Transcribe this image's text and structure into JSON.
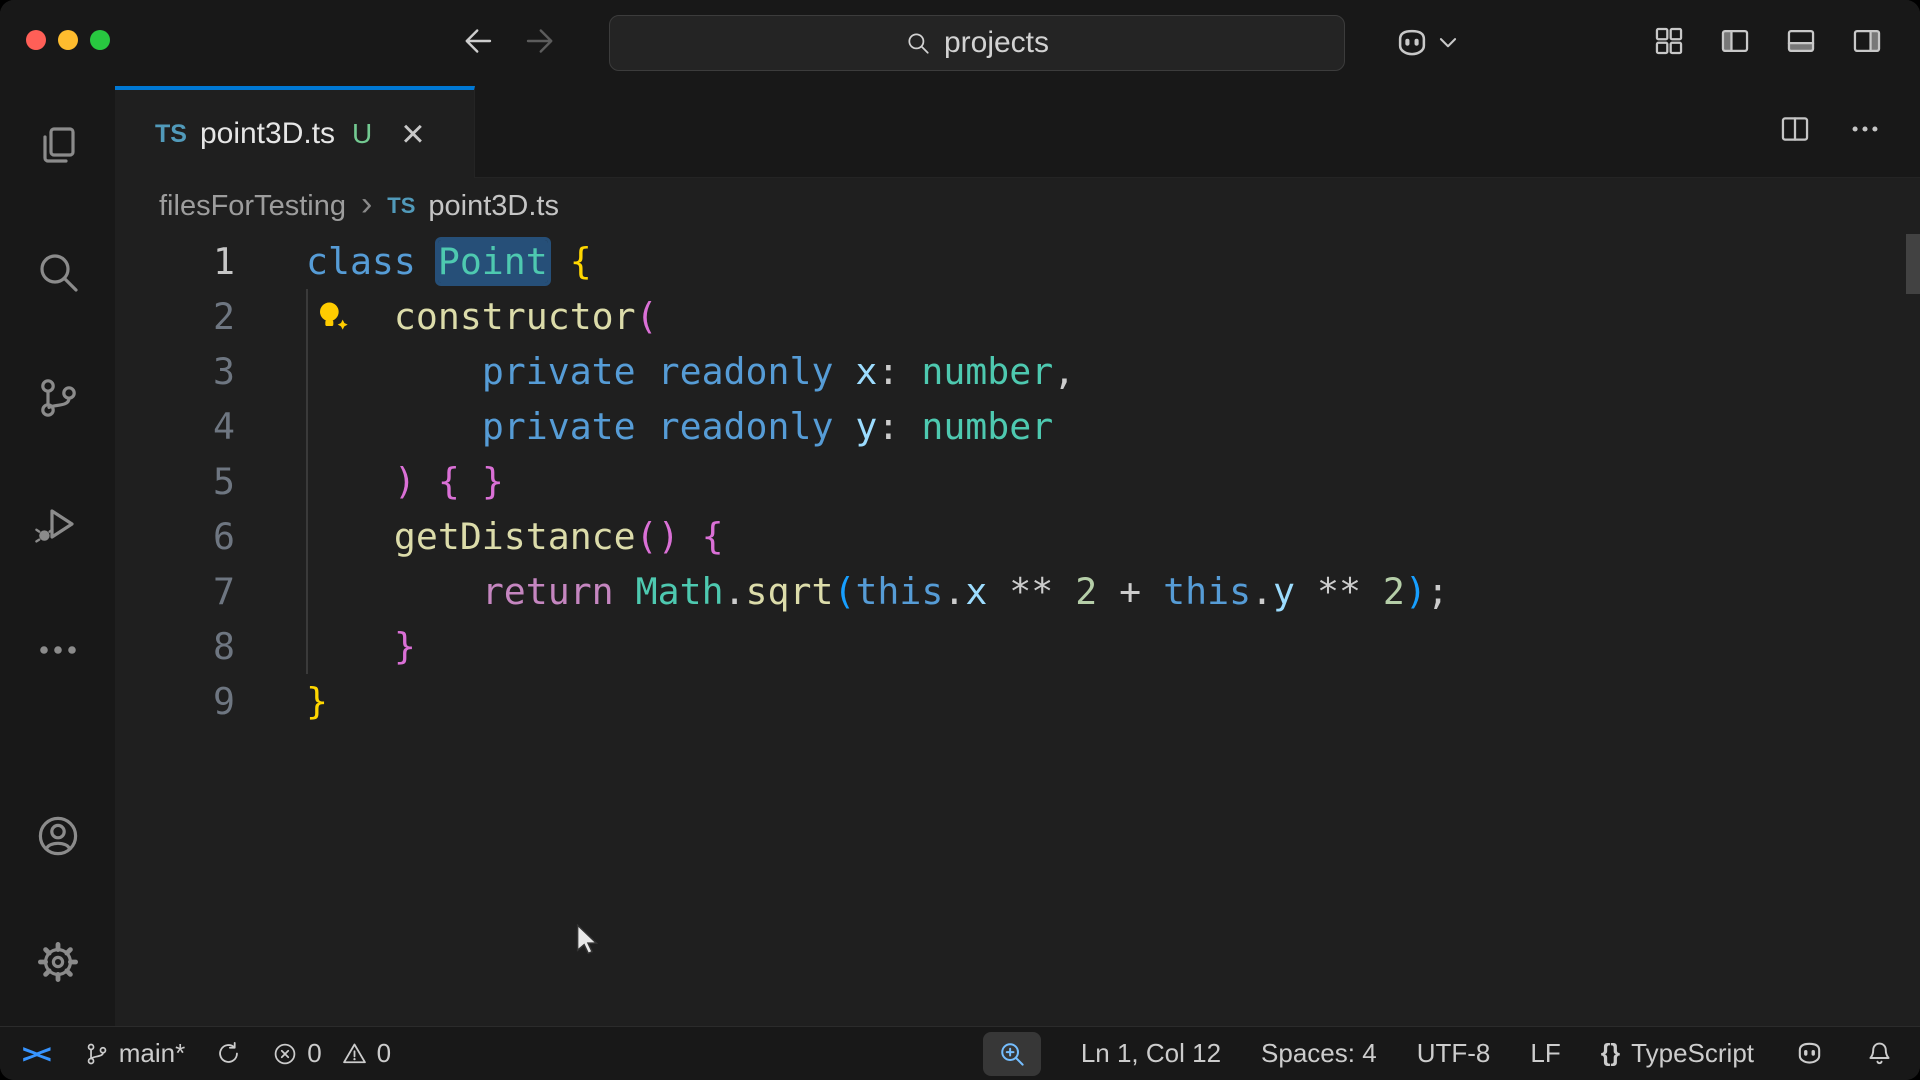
{
  "colors": {
    "shell-bg": "#181818",
    "editor-bg": "#1f1f1f",
    "accent": "#0078d4",
    "panel-border": "#2b2b2b",
    "icon-fg": "#8b8b8b",
    "ui-fg": "#cccccc",
    "dim-fg": "#6e7681",
    "breadcrumb-fg": "#9d9d9d",
    "tab-fg": "#e6e6e6",
    "untracked-green": "#73c991",
    "ts-blue": "#519aba",
    "remote-blue": "#3794ff",
    "lightbulb-yellow": "#ffcc00",
    "word-highlight": "#264f78",
    "traffic-red": "#ff5f57",
    "traffic-yellow": "#febc2e",
    "traffic-green": "#28c840",
    "searchbox-bg": "#242424",
    "searchbox-border": "#3c3c3c",
    "zoom-chip-bg": "#373737",
    "zoom-icon-blue": "#75beff",
    "scrollbar-thumb": "#79797966"
  },
  "syntax": {
    "kw": "#569cd6",
    "ctrl": "#c586c0",
    "cls": "#4ec9b0",
    "fn": "#dcdcaa",
    "var": "#9cdcfe",
    "num": "#b5cea8",
    "pl": "#cccccc",
    "b1": "#ffd700",
    "b2": "#da70d6",
    "b3": "#179fff"
  },
  "title_bar": {
    "search_value": "projects"
  },
  "editor": {
    "tab": {
      "file_icon": "TS",
      "label": "point3D.ts",
      "git_badge": "U",
      "close_glyph": "×"
    },
    "breadcrumbs": {
      "folder": "filesForTesting",
      "separator": "›",
      "file_icon": "TS",
      "file": "point3D.ts"
    },
    "code_lines": [
      {
        "num": "1",
        "active": true,
        "tokens": [
          [
            "kw",
            "class"
          ],
          [
            "pl",
            " "
          ],
          [
            "hl",
            "Point"
          ],
          [
            "pl",
            " "
          ],
          [
            "b1",
            "{"
          ]
        ]
      },
      {
        "num": "2",
        "lightbulb": true,
        "tokens": [
          [
            "pl",
            "    "
          ],
          [
            "fn",
            "constructor"
          ],
          [
            "b2",
            "("
          ]
        ]
      },
      {
        "num": "3",
        "tokens": [
          [
            "pl",
            "        "
          ],
          [
            "kw",
            "private"
          ],
          [
            "pl",
            " "
          ],
          [
            "kw",
            "readonly"
          ],
          [
            "pl",
            " "
          ],
          [
            "var",
            "x"
          ],
          [
            "pl",
            ": "
          ],
          [
            "cls",
            "number"
          ],
          [
            "pl",
            ","
          ]
        ]
      },
      {
        "num": "4",
        "tokens": [
          [
            "pl",
            "        "
          ],
          [
            "kw",
            "private"
          ],
          [
            "pl",
            " "
          ],
          [
            "kw",
            "readonly"
          ],
          [
            "pl",
            " "
          ],
          [
            "var",
            "y"
          ],
          [
            "pl",
            ": "
          ],
          [
            "cls",
            "number"
          ]
        ]
      },
      {
        "num": "5",
        "tokens": [
          [
            "pl",
            "    "
          ],
          [
            "b2",
            ")"
          ],
          [
            "pl",
            " "
          ],
          [
            "b2",
            "{"
          ],
          [
            "pl",
            " "
          ],
          [
            "b2",
            "}"
          ]
        ]
      },
      {
        "num": "6",
        "tokens": [
          [
            "pl",
            "    "
          ],
          [
            "fn",
            "getDistance"
          ],
          [
            "b2",
            "()"
          ],
          [
            "pl",
            " "
          ],
          [
            "b2",
            "{"
          ]
        ]
      },
      {
        "num": "7",
        "tokens": [
          [
            "pl",
            "        "
          ],
          [
            "ctrl",
            "return"
          ],
          [
            "pl",
            " "
          ],
          [
            "cls",
            "Math"
          ],
          [
            "pl",
            "."
          ],
          [
            "fn",
            "sqrt"
          ],
          [
            "b3",
            "("
          ],
          [
            "kw",
            "this"
          ],
          [
            "pl",
            "."
          ],
          [
            "var",
            "x"
          ],
          [
            "pl",
            " ** "
          ],
          [
            "num",
            "2"
          ],
          [
            "pl",
            " + "
          ],
          [
            "kw",
            "this"
          ],
          [
            "pl",
            "."
          ],
          [
            "var",
            "y"
          ],
          [
            "pl",
            " ** "
          ],
          [
            "num",
            "2"
          ],
          [
            "b3",
            ")"
          ],
          [
            "pl",
            ";"
          ]
        ]
      },
      {
        "num": "8",
        "tokens": [
          [
            "pl",
            "    "
          ],
          [
            "b2",
            "}"
          ]
        ]
      },
      {
        "num": "9",
        "tokens": [
          [
            "b1",
            "}"
          ]
        ]
      }
    ]
  },
  "status_bar": {
    "remote_glyph": "><",
    "branch_label": "main*",
    "errors": "0",
    "warnings": "0",
    "line_col": "Ln 1, Col 12",
    "indent": "Spaces: 4",
    "encoding": "UTF-8",
    "eol": "LF",
    "braces_glyph": "{}",
    "language": "TypeScript"
  }
}
